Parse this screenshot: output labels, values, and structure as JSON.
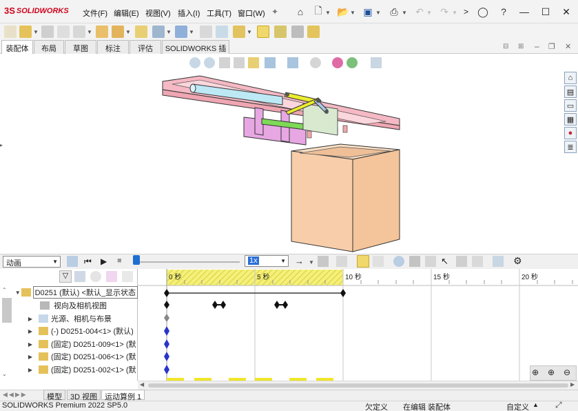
{
  "app": {
    "brand": "SOLIDWORKS",
    "brand_prefix": "3S"
  },
  "menu": [
    "文件(F)",
    "编辑(E)",
    "视图(V)",
    "插入(I)",
    "工具(T)",
    "窗口(W)"
  ],
  "command_tabs": [
    "装配体",
    "布局",
    "草图",
    "标注",
    "评估",
    "SOLIDWORKS 插件"
  ],
  "motion": {
    "study_type": "动画",
    "speed": "1x",
    "time_labels": [
      "0 秒",
      "5 秒",
      "10 秒",
      "15 秒",
      "20 秒"
    ]
  },
  "tree": {
    "root": "D0251 (默认) <默认_显示状态",
    "items": [
      "视向及相机视图",
      "光源、相机与布景",
      "(-) D0251-004<1> (默认)",
      "(固定) D0251-009<1> (默",
      "(固定) D0251-006<1> (默",
      "(固定) D0251-002<1> (默"
    ]
  },
  "bottom_tabs": [
    "模型",
    "3D 视图",
    "运动算例 1"
  ],
  "status": {
    "product": "SOLIDWORKS Premium 2022 SP5.0",
    "state": "欠定义",
    "mode": "在编辑 装配体",
    "units": "自定义"
  },
  "colors": {
    "brand_red": "#d0021b",
    "frame_pink": "#f4b9c4",
    "box_peach": "#f7cdaa",
    "rod_cyan": "#bde9f5",
    "bracket_magenta": "#e7a7e3",
    "link_yellow": "#ecec2e",
    "timeline_yellow": "#f4f07a",
    "key_blue": "#2a35c8"
  },
  "icons": [
    "home-icon",
    "new-icon",
    "open-icon",
    "save-icon",
    "print-icon",
    "undo-icon",
    "redo-icon",
    "user-icon",
    "help-icon"
  ]
}
